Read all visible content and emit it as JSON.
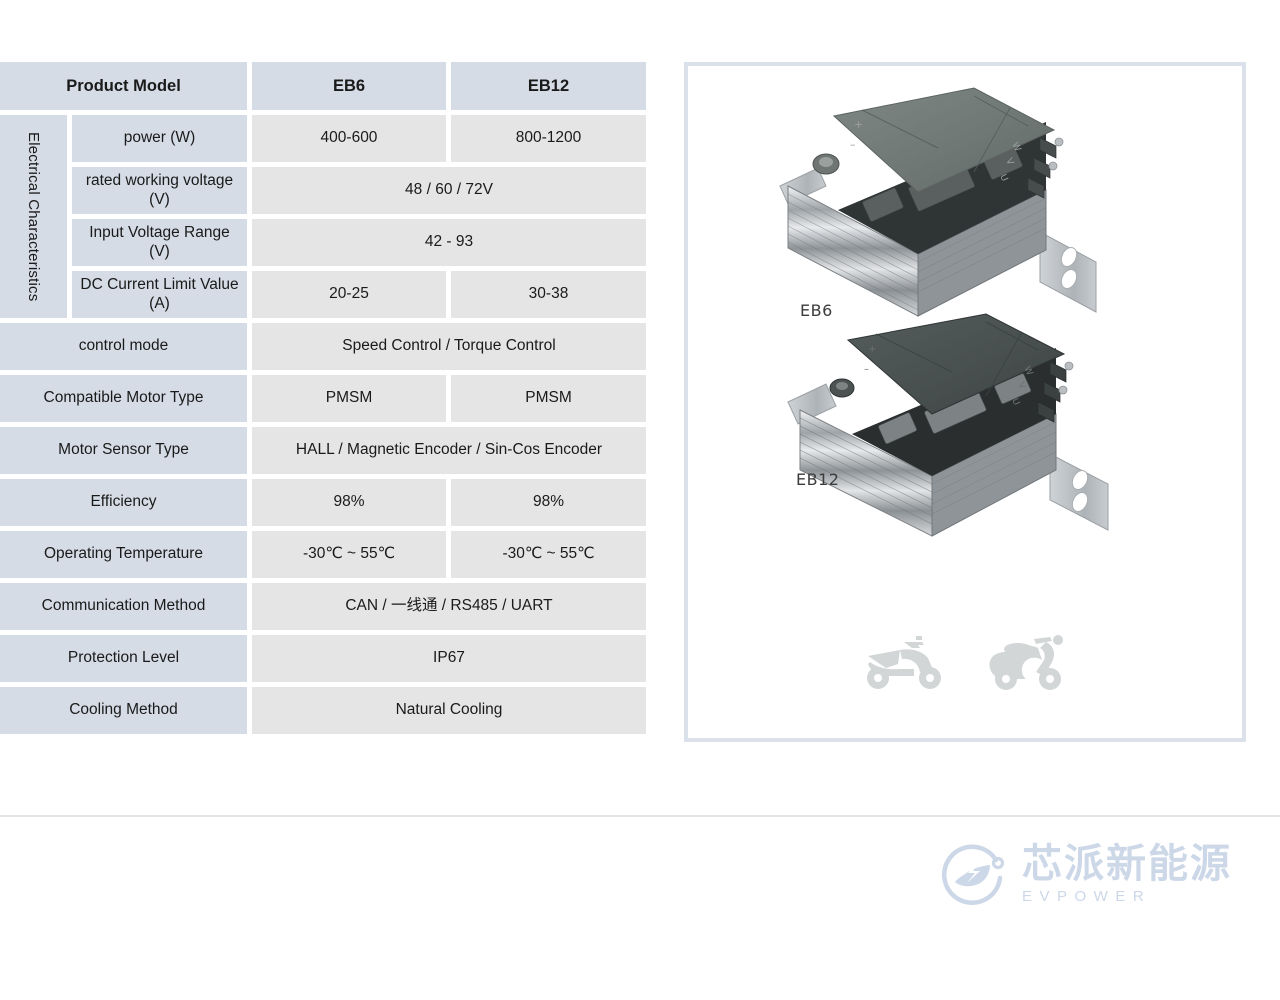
{
  "table": {
    "header": {
      "name": "Product Model",
      "col1": "EB6",
      "col2": "EB12"
    },
    "group_label": "Electrical Characteristics",
    "electrical_rows": [
      {
        "name": "power (W)",
        "eb6": "400-600",
        "eb12": "800-1200",
        "span": false
      },
      {
        "name": "rated working voltage (V)",
        "both": "48 / 60 / 72V",
        "span": true
      },
      {
        "name": "Input Voltage Range (V)",
        "both": "42 - 93",
        "span": true
      },
      {
        "name": "DC Current Limit Value (A)",
        "eb6": "20-25",
        "eb12": "30-38",
        "span": false
      }
    ],
    "general_rows": [
      {
        "name": "control mode",
        "both": "Speed Control / Torque Control",
        "span": true
      },
      {
        "name": "Compatible Motor Type",
        "eb6": "PMSM",
        "eb12": "PMSM",
        "span": false
      },
      {
        "name": "Motor Sensor Type",
        "both": "HALL / Magnetic Encoder / Sin-Cos Encoder",
        "span": true
      },
      {
        "name": "Efficiency",
        "eb6": "98%",
        "eb12": "98%",
        "span": false
      },
      {
        "name": "Operating Temperature",
        "eb6": "-30℃ ~ 55℃",
        "eb12": "-30℃ ~ 55℃",
        "span": false
      },
      {
        "name": "Communication Method",
        "both": "CAN / 一线通 / RS485 / UART",
        "span": true
      },
      {
        "name": "Protection Level",
        "both": "IP67",
        "span": true
      },
      {
        "name": "Cooling Method",
        "both": "Natural Cooling",
        "span": true
      }
    ]
  },
  "panel": {
    "units": [
      {
        "label": "EB6"
      },
      {
        "label": "EB12"
      }
    ],
    "vehicle_icons": [
      "scooter-icon",
      "moped-icon"
    ]
  },
  "footer": {
    "brand_cn": "芯派新能源",
    "brand_en": "EVPOWER"
  },
  "colors": {
    "label_cell": "#d5dce6",
    "value_cell": "#e5e5e5",
    "panel_border": "#dbe1ea",
    "brand": "#ccd7e8",
    "divider": "#e3e3e3"
  }
}
